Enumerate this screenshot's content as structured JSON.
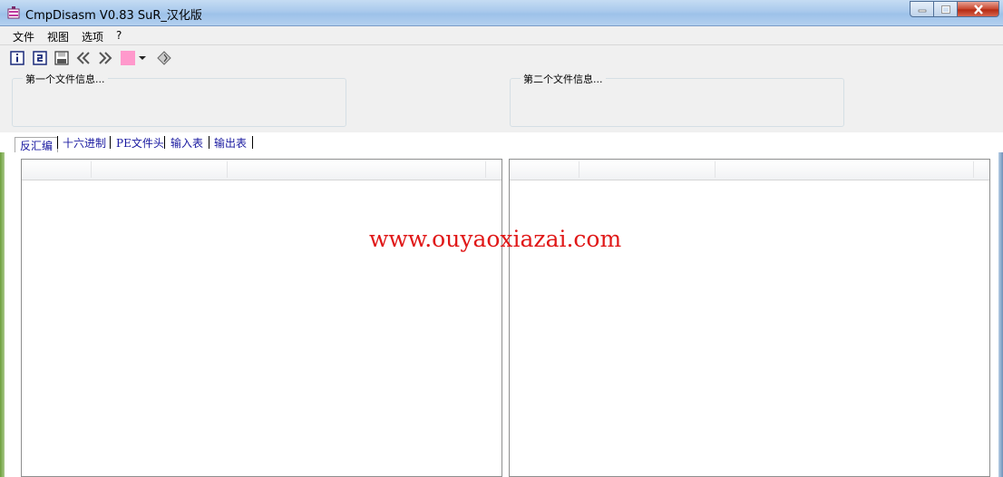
{
  "window": {
    "title": "CmpDisasm V0.83 SuR_汉化版"
  },
  "menu": {
    "items": [
      "文件",
      "视图",
      "选项",
      "?"
    ]
  },
  "toolbar": {
    "icons": [
      "info-icon",
      "refresh-icon",
      "save-icon",
      "previous-icon",
      "next-icon",
      "color-swatch",
      "dropdown-arrow-icon",
      "diamond-icon"
    ],
    "swatch_color": "#ff99cc"
  },
  "file_info": {
    "first_title": "第一个文件信息...",
    "second_title": "第二个文件信息..."
  },
  "tabs": [
    "反汇编",
    "十六进制",
    "PE文件头",
    "输入表",
    "输出表"
  ],
  "watermark": "www.ouyaoxiazai.com",
  "colors": {
    "tab_text": "#1a1aa0",
    "watermark": "#e01818",
    "close_button": "#c8462e"
  }
}
